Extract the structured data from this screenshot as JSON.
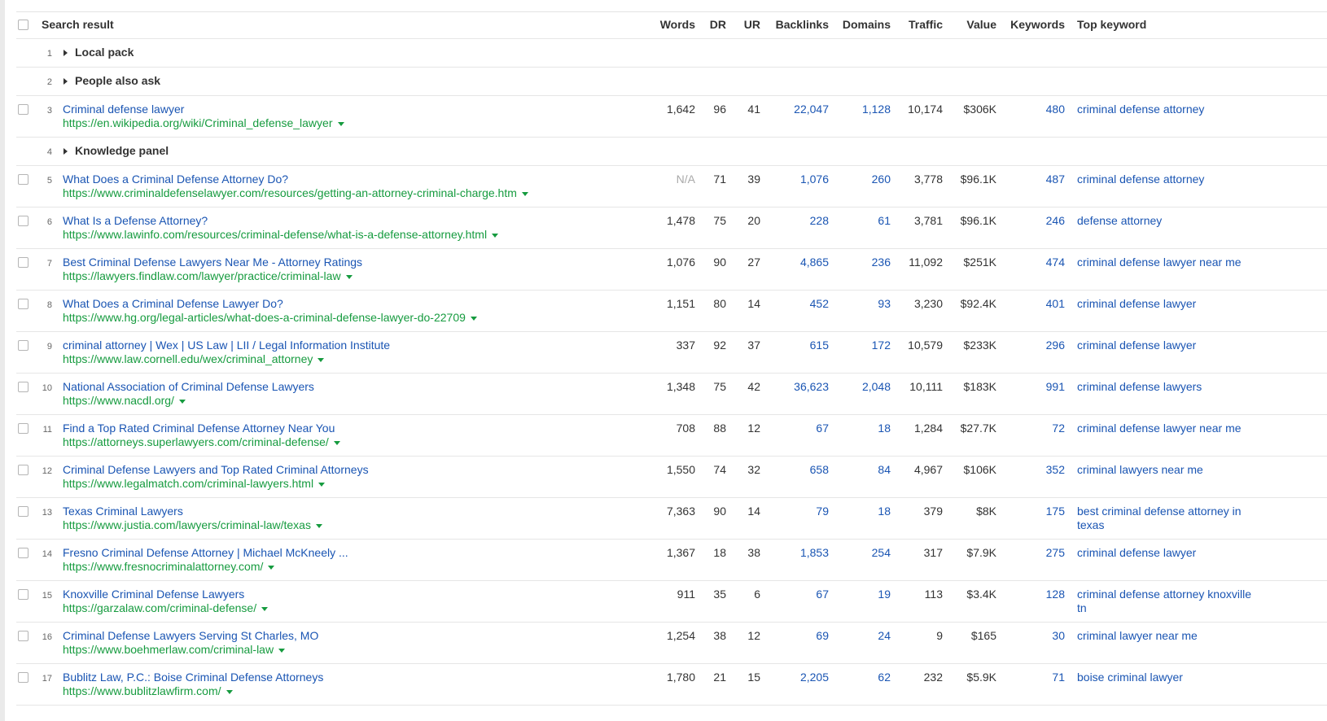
{
  "table": {
    "headers": {
      "search_result": "Search result",
      "words": "Words",
      "dr": "DR",
      "ur": "UR",
      "backlinks": "Backlinks",
      "domains": "Domains",
      "traffic": "Traffic",
      "value": "Value",
      "keywords": "Keywords",
      "top_keyword": "Top keyword"
    },
    "rows": [
      {
        "kind": "feature",
        "pos": "1",
        "name": "Local pack"
      },
      {
        "kind": "feature",
        "pos": "2",
        "name": "People also ask"
      },
      {
        "kind": "result",
        "pos": "3",
        "title": "Criminal defense lawyer",
        "url": "https://en.wikipedia.org/wiki/Criminal_defense_lawyer",
        "words": "1,642",
        "dr": "96",
        "ur": "41",
        "backlinks": "22,047",
        "domains": "1,128",
        "traffic": "10,174",
        "value": "$306K",
        "keywords": "480",
        "top_keyword": "criminal defense attorney"
      },
      {
        "kind": "feature",
        "pos": "4",
        "name": "Knowledge panel"
      },
      {
        "kind": "result",
        "pos": "5",
        "title": "What Does a Criminal Defense Attorney Do?",
        "url": "https://www.criminaldefenselawyer.com/resources/getting-an-attorney-criminal-charge.htm",
        "words": "N/A",
        "dr": "71",
        "ur": "39",
        "backlinks": "1,076",
        "domains": "260",
        "traffic": "3,778",
        "value": "$96.1K",
        "keywords": "487",
        "top_keyword": "criminal defense attorney"
      },
      {
        "kind": "result",
        "pos": "6",
        "title": "What Is a Defense Attorney?",
        "url": "https://www.lawinfo.com/resources/criminal-defense/what-is-a-defense-attorney.html",
        "words": "1,478",
        "dr": "75",
        "ur": "20",
        "backlinks": "228",
        "domains": "61",
        "traffic": "3,781",
        "value": "$96.1K",
        "keywords": "246",
        "top_keyword": "defense attorney"
      },
      {
        "kind": "result",
        "pos": "7",
        "title": "Best Criminal Defense Lawyers Near Me - Attorney Ratings",
        "url": "https://lawyers.findlaw.com/lawyer/practice/criminal-law",
        "words": "1,076",
        "dr": "90",
        "ur": "27",
        "backlinks": "4,865",
        "domains": "236",
        "traffic": "11,092",
        "value": "$251K",
        "keywords": "474",
        "top_keyword": "criminal defense lawyer near me"
      },
      {
        "kind": "result",
        "pos": "8",
        "title": "What Does a Criminal Defense Lawyer Do?",
        "url": "https://www.hg.org/legal-articles/what-does-a-criminal-defense-lawyer-do-22709",
        "words": "1,151",
        "dr": "80",
        "ur": "14",
        "backlinks": "452",
        "domains": "93",
        "traffic": "3,230",
        "value": "$92.4K",
        "keywords": "401",
        "top_keyword": "criminal defense lawyer"
      },
      {
        "kind": "result",
        "pos": "9",
        "title": "criminal attorney | Wex | US Law | LII / Legal Information Institute",
        "url": "https://www.law.cornell.edu/wex/criminal_attorney",
        "words": "337",
        "dr": "92",
        "ur": "37",
        "backlinks": "615",
        "domains": "172",
        "traffic": "10,579",
        "value": "$233K",
        "keywords": "296",
        "top_keyword": "criminal defense lawyer"
      },
      {
        "kind": "result",
        "pos": "10",
        "title": "National Association of Criminal Defense Lawyers",
        "url": "https://www.nacdl.org/",
        "words": "1,348",
        "dr": "75",
        "ur": "42",
        "backlinks": "36,623",
        "domains": "2,048",
        "traffic": "10,111",
        "value": "$183K",
        "keywords": "991",
        "top_keyword": "criminal defense lawyers"
      },
      {
        "kind": "result",
        "pos": "11",
        "title": "Find a Top Rated Criminal Defense Attorney Near You",
        "url": "https://attorneys.superlawyers.com/criminal-defense/",
        "words": "708",
        "dr": "88",
        "ur": "12",
        "backlinks": "67",
        "domains": "18",
        "traffic": "1,284",
        "value": "$27.7K",
        "keywords": "72",
        "top_keyword": "criminal defense lawyer near me"
      },
      {
        "kind": "result",
        "pos": "12",
        "title": "Criminal Defense Lawyers and Top Rated Criminal Attorneys",
        "url": "https://www.legalmatch.com/criminal-lawyers.html",
        "words": "1,550",
        "dr": "74",
        "ur": "32",
        "backlinks": "658",
        "domains": "84",
        "traffic": "4,967",
        "value": "$106K",
        "keywords": "352",
        "top_keyword": "criminal lawyers near me"
      },
      {
        "kind": "result",
        "pos": "13",
        "title": "Texas Criminal Lawyers",
        "url": "https://www.justia.com/lawyers/criminal-law/texas",
        "words": "7,363",
        "dr": "90",
        "ur": "14",
        "backlinks": "79",
        "domains": "18",
        "traffic": "379",
        "value": "$8K",
        "keywords": "175",
        "top_keyword": "best criminal defense attorney in texas"
      },
      {
        "kind": "result",
        "pos": "14",
        "title": "Fresno Criminal Defense Attorney | Michael McKneely ...",
        "url": "https://www.fresnocriminalattorney.com/",
        "words": "1,367",
        "dr": "18",
        "ur": "38",
        "backlinks": "1,853",
        "domains": "254",
        "traffic": "317",
        "value": "$7.9K",
        "keywords": "275",
        "top_keyword": "criminal defense lawyer"
      },
      {
        "kind": "result",
        "pos": "15",
        "title": "Knoxville Criminal Defense Lawyers",
        "url": "https://garzalaw.com/criminal-defense/",
        "words": "911",
        "dr": "35",
        "ur": "6",
        "backlinks": "67",
        "domains": "19",
        "traffic": "113",
        "value": "$3.4K",
        "keywords": "128",
        "top_keyword": "criminal defense attorney knoxville tn"
      },
      {
        "kind": "result",
        "pos": "16",
        "title": "Criminal Defense Lawyers Serving St Charles, MO",
        "url": "https://www.boehmerlaw.com/criminal-law",
        "words": "1,254",
        "dr": "38",
        "ur": "12",
        "backlinks": "69",
        "domains": "24",
        "traffic": "9",
        "value": "$165",
        "keywords": "30",
        "top_keyword": "criminal lawyer near me"
      },
      {
        "kind": "result",
        "pos": "17",
        "title": "Bublitz Law, P.C.: Boise Criminal Defense Attorneys",
        "url": "https://www.bublitzlawfirm.com/",
        "words": "1,780",
        "dr": "21",
        "ur": "15",
        "backlinks": "2,205",
        "domains": "62",
        "traffic": "232",
        "value": "$5.9K",
        "keywords": "71",
        "top_keyword": "boise criminal lawyer"
      }
    ]
  }
}
